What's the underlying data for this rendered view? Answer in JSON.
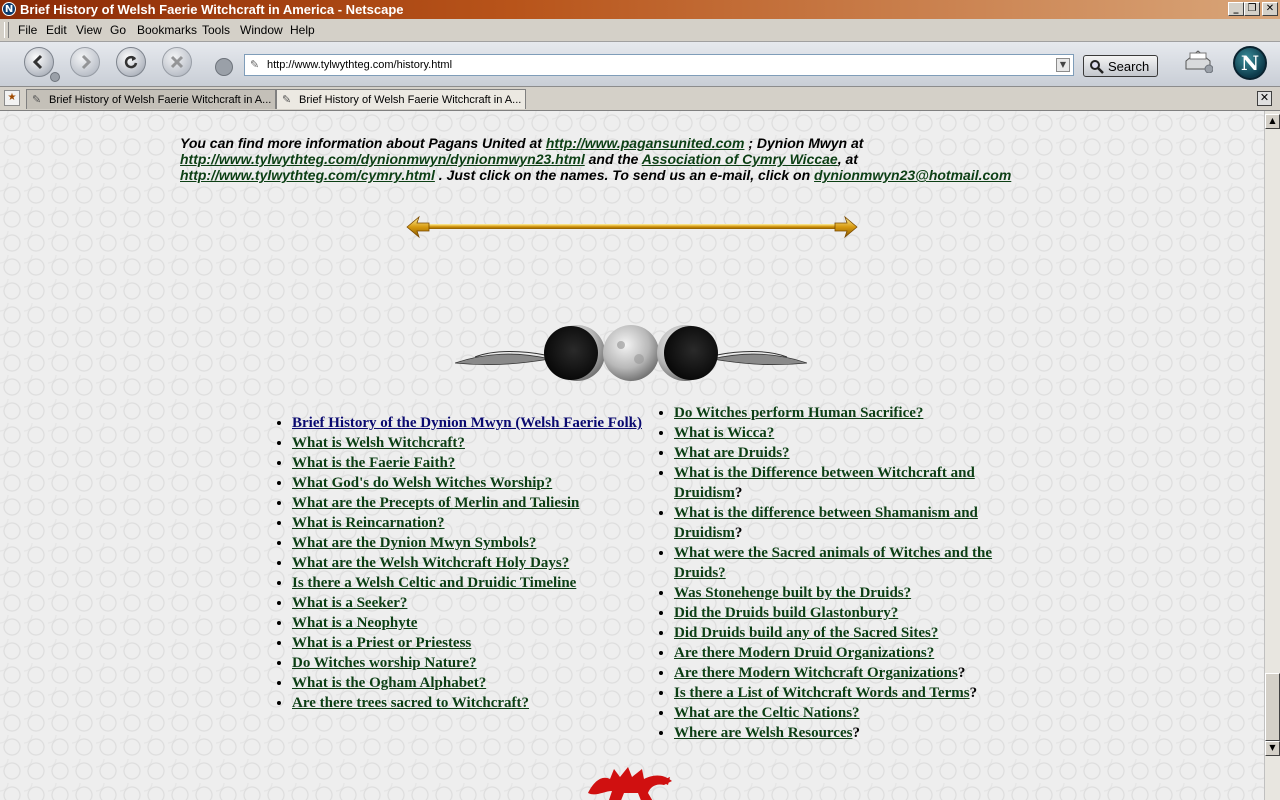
{
  "window": {
    "title": "Brief History of Welsh Faerie Witchcraft in America - Netscape"
  },
  "menu": [
    "File",
    "Edit",
    "View",
    "Go",
    "Bookmarks",
    "Tools",
    "Window",
    "Help"
  ],
  "toolbar": {
    "url": "http://www.tylwythteg.com/history.html",
    "search_label": "Search"
  },
  "tabs": [
    {
      "label": "Brief History of Welsh Faerie Witchcraft in A...",
      "active": false
    },
    {
      "label": "Brief History of Welsh Faerie Witchcraft in A...",
      "active": true
    }
  ],
  "intro": {
    "t1": "You can find more information about Pagans United at ",
    "l1": "http://www.pagansunited.com",
    "t2": " ; Dynion Mwyn at ",
    "l2": "http://www.tylwythteg.com/dynionmwyn/dynionmwyn23.html",
    "t3": " and the ",
    "l3": "Association of Cymry Wiccae",
    "t4": ", at ",
    "l4": "http://www.tylwythteg.com/cymry.html",
    "t5": " . Just click on the names.  To send us an e-mail, click on ",
    "l5": "dynionmwyn23@hotmail.com"
  },
  "left_links": [
    {
      "text": "Brief History of the Dynion Mwyn (Welsh Faerie Folk)",
      "suffix": "",
      "visited": true
    },
    {
      "text": "What is Welsh Witchcraft?",
      "suffix": ""
    },
    {
      "text": "What is the Faerie Faith?",
      "suffix": ""
    },
    {
      "text": "What God's do Welsh Witches Worship?",
      "suffix": ""
    },
    {
      "text": "What are the Precepts of Merlin and Taliesin",
      "suffix": ""
    },
    {
      "text": "What is Reincarnation?",
      "suffix": ""
    },
    {
      "text": "What are the Dynion Mwyn Symbols?",
      "suffix": ""
    },
    {
      "text": "What are the Welsh Witchcraft Holy Days?",
      "suffix": ""
    },
    {
      "text": "Is there a Welsh Celtic and Druidic Timeline",
      "suffix": ""
    },
    {
      "text": "What is a Seeker?",
      "suffix": ""
    },
    {
      "text": "What is a Neophyte",
      "suffix": ""
    },
    {
      "text": "What is a Priest or Priestess",
      "suffix": ""
    },
    {
      "text": "Do Witches worship Nature?",
      "suffix": ""
    },
    {
      "text": "What is the Ogham Alphabet?",
      "suffix": ""
    },
    {
      "text": "Are there trees sacred to Witchcraft?",
      "suffix": ""
    }
  ],
  "right_links": [
    {
      "text": "Do Witches perform Human Sacrifice?",
      "suffix": ""
    },
    {
      "text": "What is Wicca?",
      "suffix": ""
    },
    {
      "text": "What are Druids?",
      "suffix": ""
    },
    {
      "text": "What is the Difference between Witchcraft and Druidism",
      "suffix": "?"
    },
    {
      "text": "What is the difference between Shamanism and Druidism",
      "suffix": "?"
    },
    {
      "text": "What were the Sacred animals of Witches and the Druids?",
      "suffix": ""
    },
    {
      "text": "Was Stonehenge built by the Druids?",
      "suffix": ""
    },
    {
      "text": "Did the Druids build Glastonbury?",
      "suffix": ""
    },
    {
      "text": "Did Druids build any of the Sacred Sites?",
      "suffix": ""
    },
    {
      "text": "Are there Modern Druid Organizations?",
      "suffix": ""
    },
    {
      "text": "Are there Modern Witchcraft Organizations",
      "suffix": "?"
    },
    {
      "text": "Is there a List of Witchcraft Words and Terms",
      "suffix": "?"
    },
    {
      "text": "What are the Celtic Nations?",
      "suffix": ""
    },
    {
      "text": "Where are Welsh Resources",
      "suffix": "?"
    }
  ],
  "colors": {
    "link": "#0c3f14",
    "visited_link": "#0a0a70",
    "title_bar": "#8b2a06"
  }
}
